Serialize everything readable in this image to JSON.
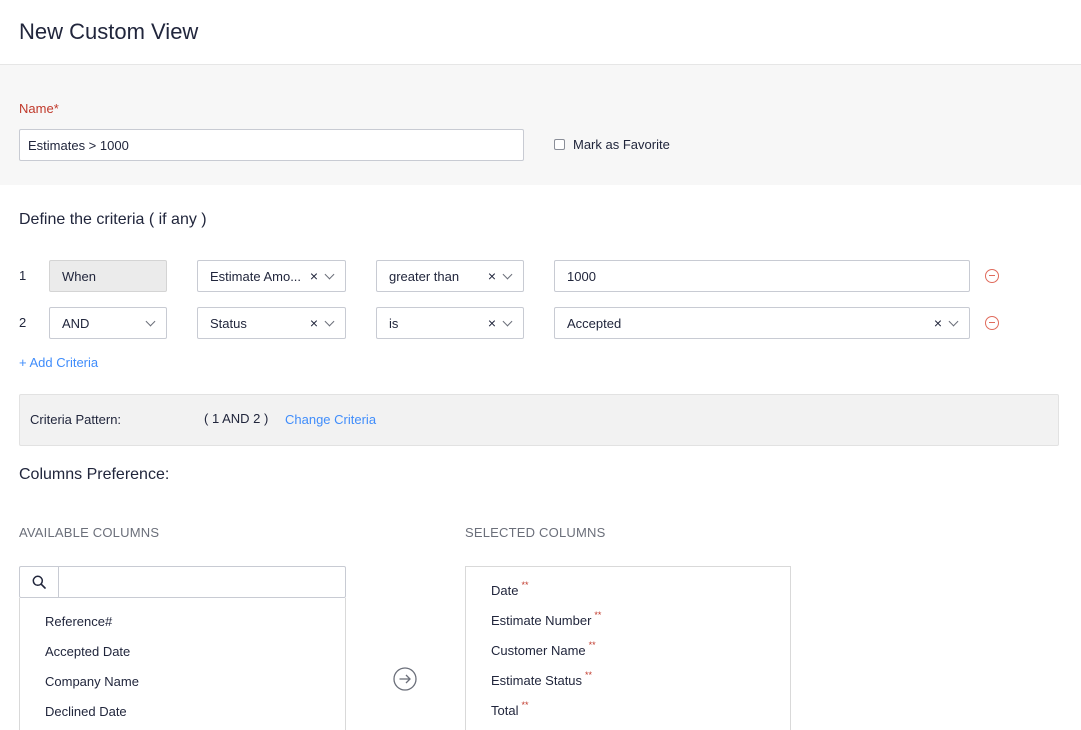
{
  "header": {
    "title": "New Custom View"
  },
  "name_section": {
    "label": "Name",
    "required_mark": "*",
    "value": "Estimates > 1000",
    "favorite_label": "Mark as Favorite"
  },
  "criteria": {
    "title": "Define the criteria ( if any )",
    "rows": [
      {
        "num": "1",
        "connector": "When",
        "field": "Estimate Amo...",
        "operator": "greater than",
        "value": "1000"
      },
      {
        "num": "2",
        "connector": "AND",
        "field": "Status",
        "operator": "is",
        "value": "Accepted"
      }
    ],
    "clear_glyph": "×",
    "add_label": "+ Add Criteria",
    "pattern_label": "Criteria Pattern:",
    "pattern_value": "( 1 AND 2 )",
    "change_label": "Change Criteria"
  },
  "columns": {
    "title": "Columns Preference:",
    "available_heading": "AVAILABLE COLUMNS",
    "selected_heading": "SELECTED COLUMNS",
    "search_placeholder": "",
    "available": [
      "Reference#",
      "Accepted Date",
      "Company Name",
      "Declined Date"
    ],
    "selected": [
      "Date",
      "Estimate Number",
      "Customer Name",
      "Estimate Status",
      "Total"
    ],
    "required_mark": "**"
  },
  "colors": {
    "accent": "#408dfb",
    "required": "#c0392b",
    "remove": "#e06b5c"
  },
  "icons": {
    "search": "search-icon",
    "remove": "remove-circle-icon",
    "move": "arrow-right-circle-icon"
  }
}
